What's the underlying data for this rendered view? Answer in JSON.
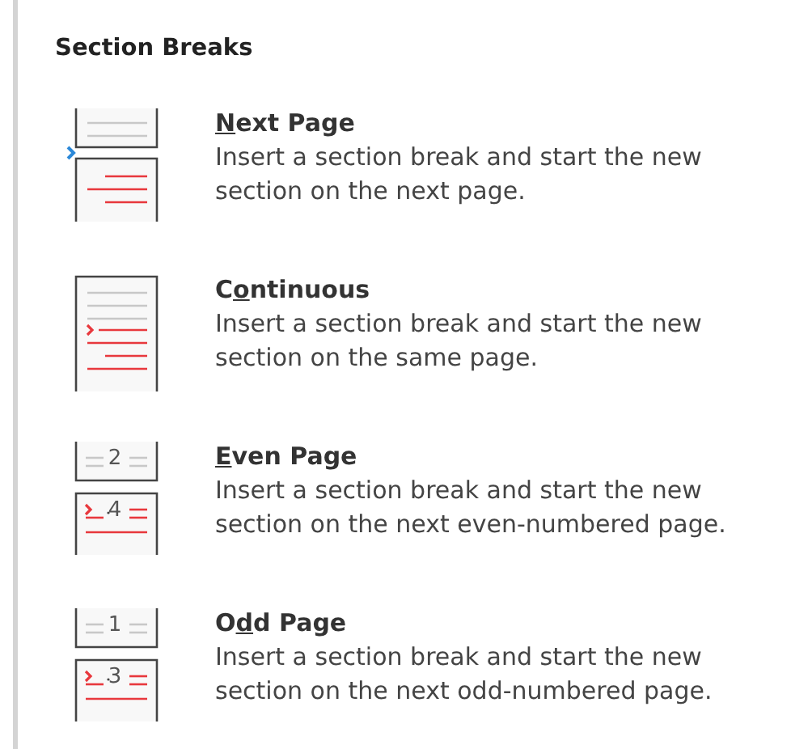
{
  "menu": {
    "header": "Section Breaks",
    "items": [
      {
        "kind": "next_page",
        "title": [
          {
            "text": "N",
            "underlined": true
          },
          {
            "text": "ext Page",
            "underlined": false
          }
        ],
        "description": "Insert a section break and start the new section on the next page."
      },
      {
        "kind": "continuous",
        "title": [
          {
            "text": "C",
            "underlined": false
          },
          {
            "text": "o",
            "underlined": true
          },
          {
            "text": "ntinuous",
            "underlined": false
          }
        ],
        "description": "Insert a section break and start the new section on the same page."
      },
      {
        "kind": "even_page",
        "icon_numbers": [
          "2",
          "4"
        ],
        "title": [
          {
            "text": "E",
            "underlined": true
          },
          {
            "text": "ven Page",
            "underlined": false
          }
        ],
        "description": "Insert a section break and start the new section on the next even-numbered page."
      },
      {
        "kind": "odd_page",
        "icon_numbers": [
          "1",
          "3"
        ],
        "title": [
          {
            "text": "O",
            "underlined": false
          },
          {
            "text": "d",
            "underlined": true
          },
          {
            "text": "d Page",
            "underlined": false
          }
        ],
        "description": "Insert a section break and start the new section on the next odd-numbered page."
      }
    ]
  }
}
